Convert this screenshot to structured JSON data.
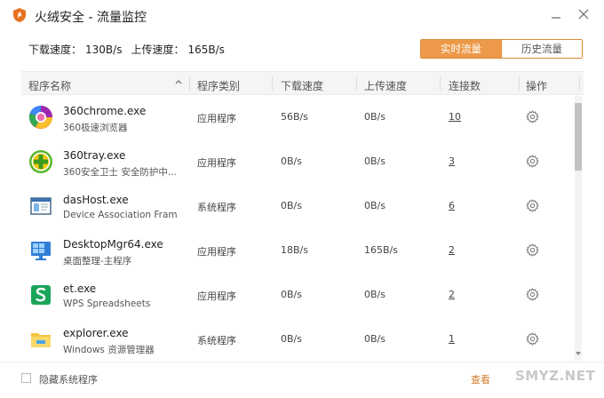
{
  "window": {
    "title": "火绒安全 - 流量监控"
  },
  "speeds": {
    "download_label": "下载速度：",
    "download_value": "130B/s",
    "upload_label": "上传速度：",
    "upload_value": "165B/s"
  },
  "tabs": {
    "realtime": "实时流量",
    "history": "历史流量"
  },
  "table": {
    "columns": {
      "name": "程序名称",
      "type": "程序类别",
      "down": "下载速度",
      "up": "上传速度",
      "conn": "连接数",
      "action": "操作"
    },
    "rows": [
      {
        "name": "360chrome.exe",
        "desc": "360极速浏览器",
        "type": "应用程序",
        "down": "56B/s",
        "up": "0B/s",
        "conn": "10",
        "icon": "chrome-icon"
      },
      {
        "name": "360tray.exe",
        "desc": "360安全卫士 安全防护中...",
        "type": "应用程序",
        "down": "0B/s",
        "up": "0B/s",
        "conn": "3",
        "icon": "360-icon"
      },
      {
        "name": "dasHost.exe",
        "desc": "Device Association Fram...",
        "type": "系统程序",
        "down": "0B/s",
        "up": "0B/s",
        "conn": "6",
        "icon": "window-app-icon"
      },
      {
        "name": "DesktopMgr64.exe",
        "desc": "桌面整理-主程序",
        "type": "应用程序",
        "down": "18B/s",
        "up": "165B/s",
        "conn": "2",
        "icon": "monitor-icon"
      },
      {
        "name": "et.exe",
        "desc": "WPS Spreadsheets",
        "type": "应用程序",
        "down": "0B/s",
        "up": "0B/s",
        "conn": "2",
        "icon": "wps-spreadsheet-icon"
      },
      {
        "name": "explorer.exe",
        "desc": "Windows 资源管理器",
        "type": "系统程序",
        "down": "0B/s",
        "up": "0B/s",
        "conn": "1",
        "icon": "folder-icon"
      }
    ]
  },
  "footer": {
    "hide_system": "隐藏系统程序",
    "link": "查看",
    "watermark": "SMYZ.NET"
  },
  "colors": {
    "accent": "#ec9a4a",
    "accent_border": "#dd8a3c",
    "logo": "#e8731f"
  }
}
